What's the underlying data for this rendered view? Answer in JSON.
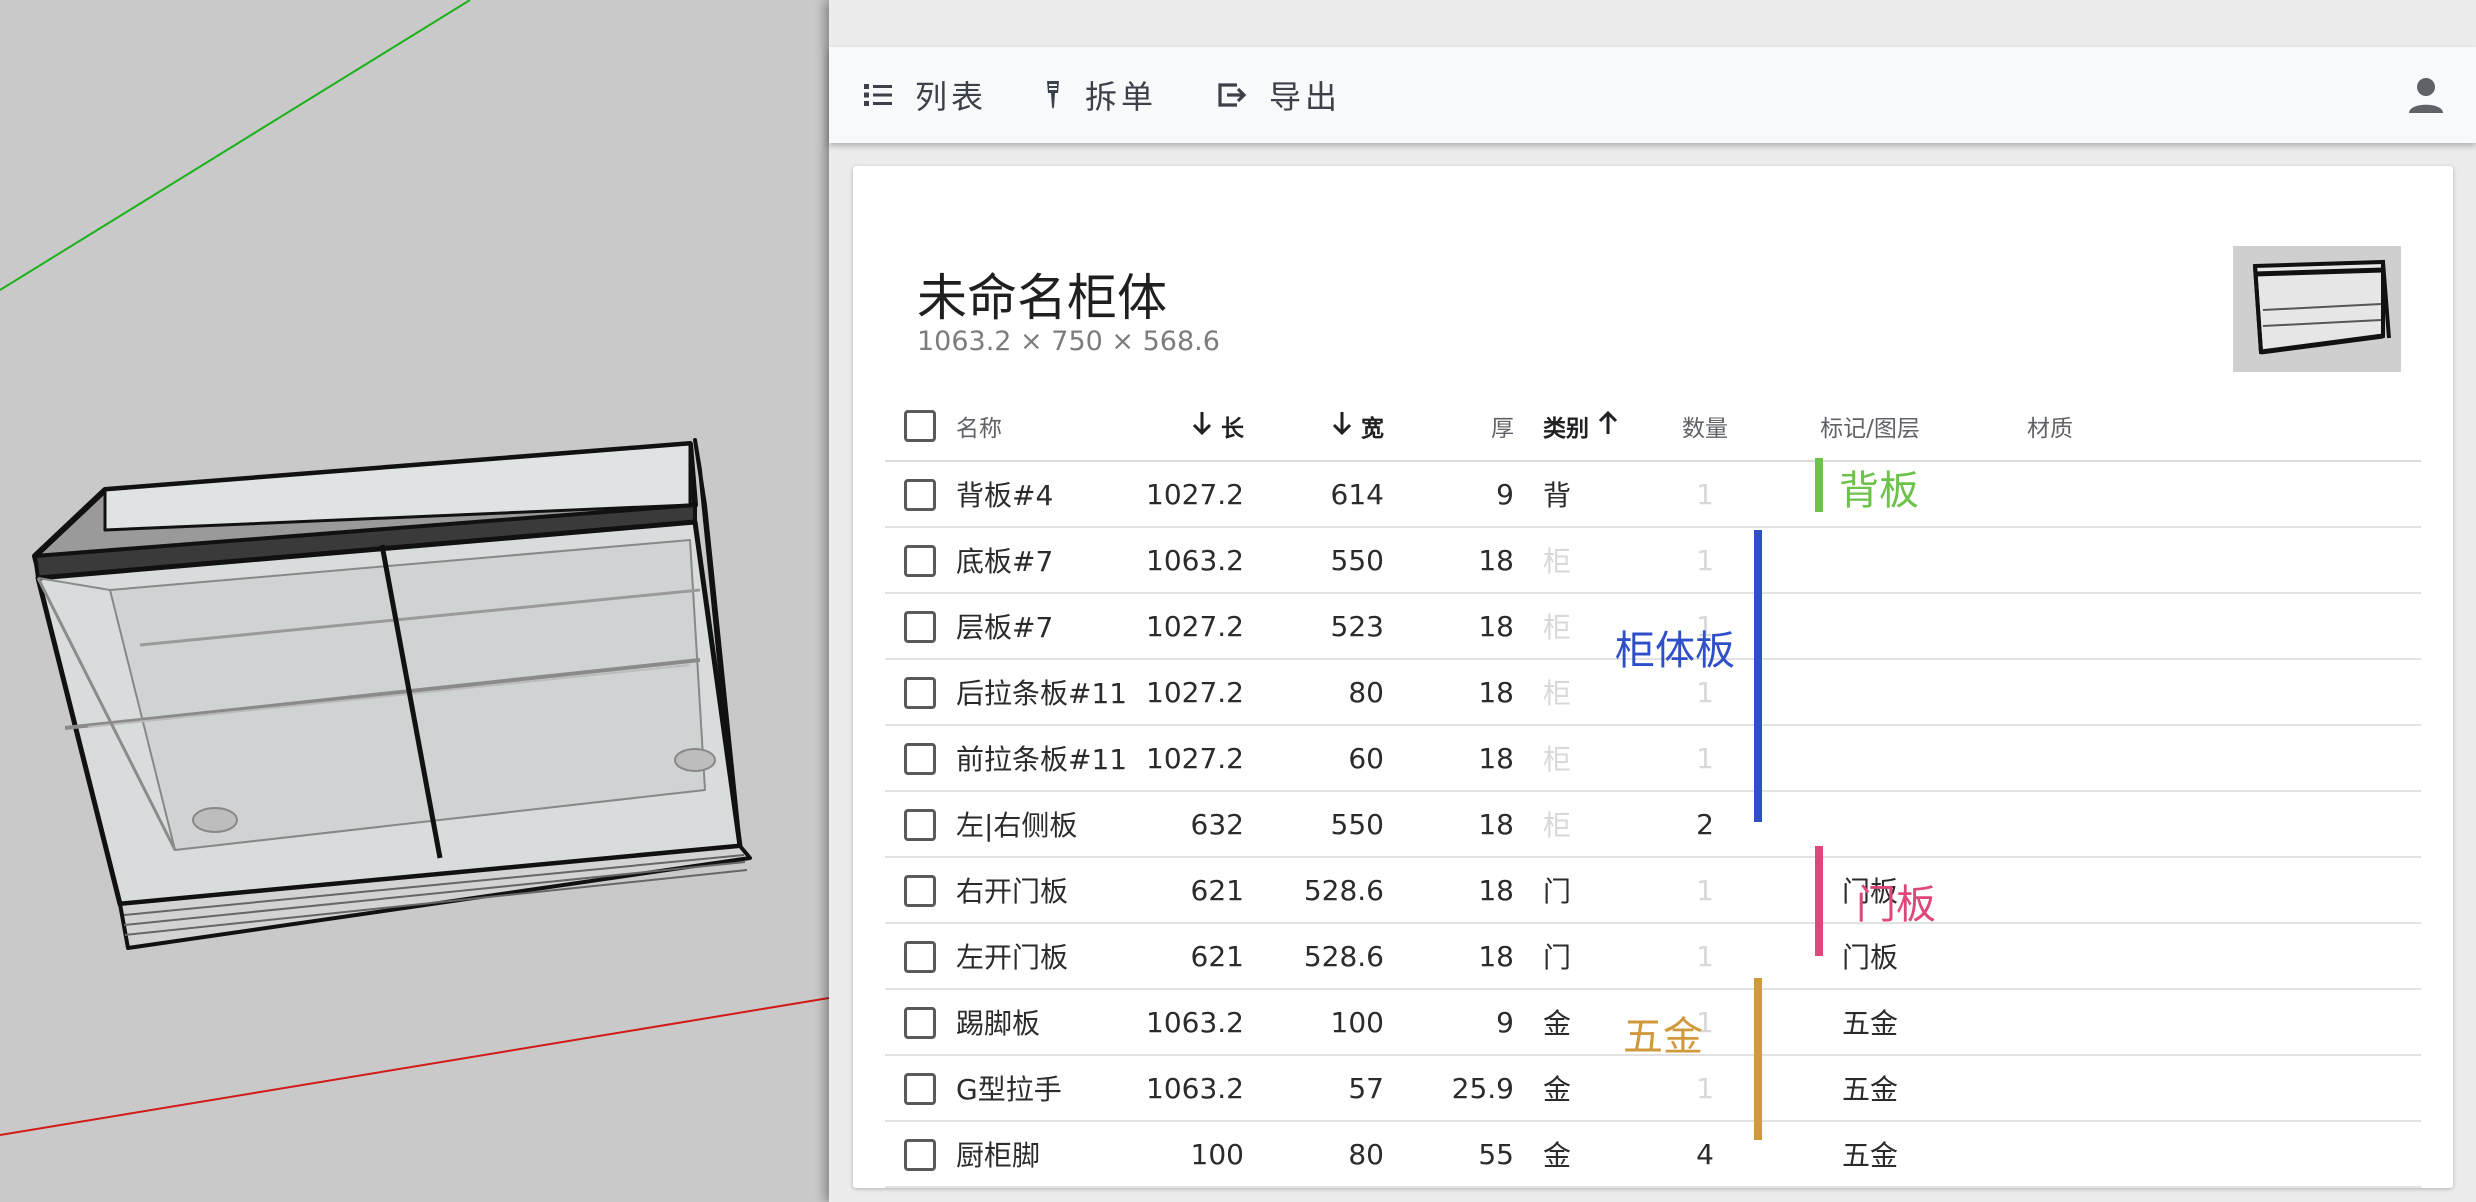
{
  "colors": {
    "back_panel": "#6cc24a",
    "cabinet_panel": "#2f4fc9",
    "door_panel": "#e0457b",
    "hardware": "#d09a3c",
    "axis_green": "#19b219",
    "axis_red": "#d11a1a"
  },
  "toolbar": {
    "list_label": "列表",
    "split_label": "拆单",
    "export_label": "导出",
    "list_icon": "list-icon",
    "split_icon": "screwdriver-icon",
    "export_icon": "export-icon",
    "user_icon": "user-icon"
  },
  "cabinet": {
    "title": "未命名柜体",
    "dims": "1063.2 × 750 × 568.6"
  },
  "table": {
    "headers": {
      "name": "名称",
      "length": "长",
      "width": "宽",
      "thickness": "厚",
      "category": "类别",
      "qty": "数量",
      "tag": "标记/图层",
      "material": "材质"
    },
    "rows": [
      {
        "name": "背板#4",
        "length": "1027.2",
        "width": "614",
        "thickness": "9",
        "category": "背",
        "qty": "1",
        "tag": "",
        "material": ""
      },
      {
        "name": "底板#7",
        "length": "1063.2",
        "width": "550",
        "thickness": "18",
        "category": "柜",
        "qty": "1",
        "tag": "",
        "material": ""
      },
      {
        "name": "层板#7",
        "length": "1027.2",
        "width": "523",
        "thickness": "18",
        "category": "柜",
        "qty": "1",
        "tag": "",
        "material": ""
      },
      {
        "name": "后拉条板#11",
        "length": "1027.2",
        "width": "80",
        "thickness": "18",
        "category": "柜",
        "qty": "1",
        "tag": "",
        "material": ""
      },
      {
        "name": "前拉条板#11",
        "length": "1027.2",
        "width": "60",
        "thickness": "18",
        "category": "柜",
        "qty": "1",
        "tag": "",
        "material": ""
      },
      {
        "name": "左|右侧板",
        "length": "632",
        "width": "550",
        "thickness": "18",
        "category": "柜",
        "qty": "2",
        "tag": "",
        "material": ""
      },
      {
        "name": "右开门板",
        "length": "621",
        "width": "528.6",
        "thickness": "18",
        "category": "门",
        "qty": "1",
        "tag": "门板",
        "material": ""
      },
      {
        "name": "左开门板",
        "length": "621",
        "width": "528.6",
        "thickness": "18",
        "category": "门",
        "qty": "1",
        "tag": "门板",
        "material": ""
      },
      {
        "name": "踢脚板",
        "length": "1063.2",
        "width": "100",
        "thickness": "9",
        "category": "金",
        "qty": "1",
        "tag": "五金",
        "material": ""
      },
      {
        "name": "G型拉手",
        "length": "1063.2",
        "width": "57",
        "thickness": "25.9",
        "category": "金",
        "qty": "1",
        "tag": "五金",
        "material": ""
      },
      {
        "name": "厨柜脚",
        "length": "100",
        "width": "80",
        "thickness": "55",
        "category": "金",
        "qty": "4",
        "tag": "五金",
        "material": ""
      }
    ]
  },
  "annotations": {
    "back": "背板",
    "cabinet": "柜体板",
    "door": "门板",
    "hardware": "五金"
  }
}
